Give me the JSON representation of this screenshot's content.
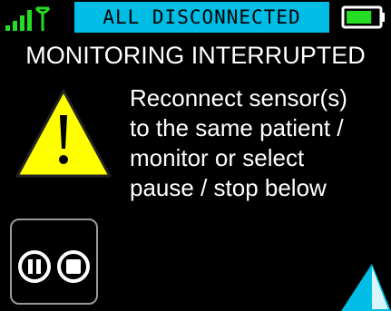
{
  "status_bar": {
    "text": "ALL DISCONNECTED"
  },
  "battery": {
    "level": 0.8,
    "color": "#22dd22"
  },
  "title": "MONITORING INTERRUPTED",
  "message_lines": [
    "Reconnect sensor(s)",
    "to the same patient /",
    "monitor or select",
    "pause / stop below"
  ],
  "colors": {
    "status_bar": "#00bde6",
    "signal": "#22dd22",
    "warning": "#ffff00",
    "accent": "#00bde6"
  },
  "icons": [
    "signal-strength-icon",
    "antenna-icon",
    "battery-icon",
    "warning-icon",
    "pause-icon",
    "stop-icon",
    "triangle-icon"
  ]
}
